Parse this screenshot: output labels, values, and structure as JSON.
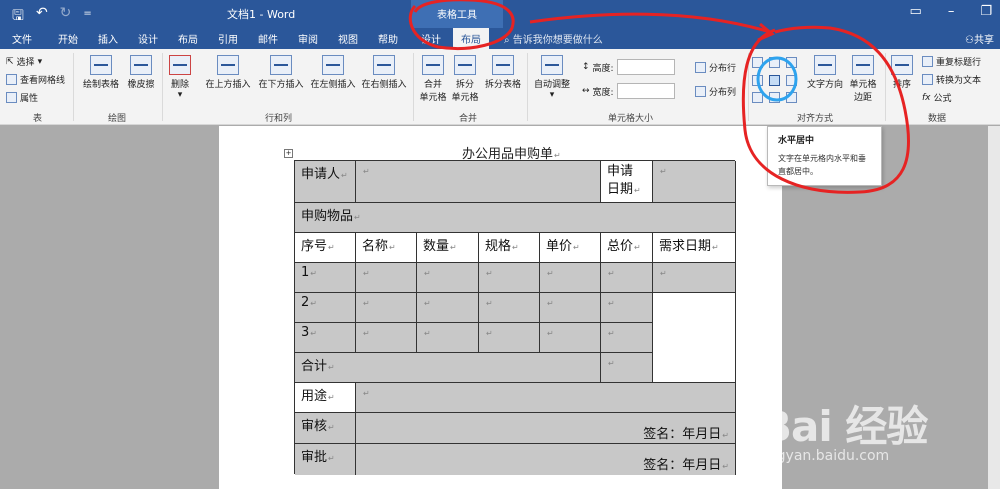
{
  "titlebar": {
    "doc_title": "文档1  -  Word",
    "context_tab": "表格工具"
  },
  "tabs": [
    "文件",
    "开始",
    "插入",
    "设计",
    "布局",
    "引用",
    "邮件",
    "审阅",
    "视图",
    "帮助",
    "设计",
    "布局"
  ],
  "search_hint": "告诉我你想要做什么",
  "share_label": "共享",
  "ribbon": {
    "table": {
      "select": "选择",
      "gridlines": "查看网格线",
      "properties": "属性",
      "label": "表"
    },
    "draw": {
      "draw_table": "绘制表格",
      "eraser": "橡皮擦",
      "label": "绘图"
    },
    "rows_cols": {
      "delete": "删除",
      "insert_above": "在上方插入",
      "insert_below": "在下方插入",
      "insert_left": "在左侧插入",
      "insert_right": "在右侧插入",
      "label": "行和列"
    },
    "merge": {
      "merge_cells": "合并\n单元格",
      "split_cells": "拆分\n单元格",
      "split_table": "拆分表格",
      "label": "合并"
    },
    "cell_size": {
      "autofit": "自动调整",
      "height_label": "高度:",
      "width_label": "宽度:",
      "distribute_rows": "分布行",
      "distribute_cols": "分布列",
      "label": "单元格大小"
    },
    "alignment": {
      "text_direction": "文字方向",
      "cell_margins": "单元格\n边距",
      "label": "对齐方式"
    },
    "data": {
      "sort": "排序",
      "repeat_header": "重复标题行",
      "convert": "转换为文本",
      "formula": "公式",
      "label": "数据"
    }
  },
  "tooltip": {
    "title": "水平居中",
    "desc": "文字在单元格内水平和垂直都居中。"
  },
  "document": {
    "heading": "办公用品申购单",
    "applicant": "申请人",
    "apply_date": "申请\n日期",
    "items_label": "申购物品",
    "headers": [
      "序号",
      "名称",
      "数量",
      "规格",
      "单价",
      "总价",
      "需求日期"
    ],
    "rows": [
      "1",
      "2",
      "3"
    ],
    "total": "合计",
    "purpose": "用途",
    "review": "审核",
    "approve": "审批",
    "signature": "签名：年月日"
  },
  "watermark": {
    "logo": "Bai 经验",
    "url": "jingyan.baidu.com"
  },
  "colors": {
    "ribbon_blue": "#2b579a",
    "annotation_red": "#e62323",
    "highlight_blue": "#2ea3ee"
  }
}
